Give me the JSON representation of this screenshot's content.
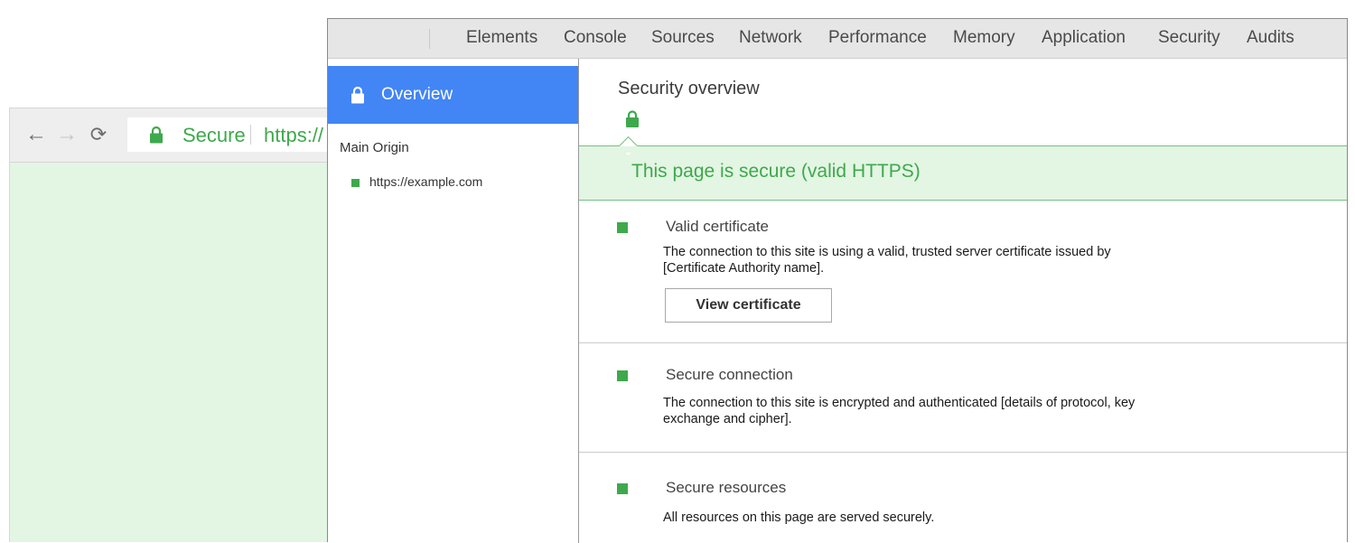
{
  "browser": {
    "address_bar": {
      "secure_label": "Secure",
      "url_text": "https://"
    }
  },
  "devtools": {
    "tabs": [
      {
        "label": "Elements"
      },
      {
        "label": "Console"
      },
      {
        "label": "Sources"
      },
      {
        "label": "Network"
      },
      {
        "label": "Performance"
      },
      {
        "label": "Memory"
      },
      {
        "label": "Application"
      },
      {
        "label": "Security"
      },
      {
        "label": "Audits"
      }
    ],
    "sidebar": {
      "overview_label": "Overview",
      "main_origin_heading": "Main Origin",
      "origins": [
        {
          "url": "https://example.com",
          "status": "secure"
        }
      ]
    },
    "main": {
      "title": "Security overview",
      "summary": "This page is secure (valid HTTPS)",
      "sections": [
        {
          "title": "Valid certificate",
          "description": "The connection to this site is using a valid, trusted server certificate issued by [Certificate Authority name].",
          "button_label": "View certificate"
        },
        {
          "title": "Secure connection",
          "description": "The connection to this site is encrypted and authenticated [details of protocol, key exchange and cipher]."
        },
        {
          "title": "Secure resources",
          "description": "All resources on this page are served securely."
        }
      ]
    }
  },
  "colors": {
    "secure_green": "#3ea94c",
    "secure_bg": "#e3f5e3",
    "selected_blue": "#4285f4"
  },
  "icons": {
    "back": "arrow-left-icon",
    "forward": "arrow-right-icon",
    "reload": "reload-icon",
    "lock": "lock-icon",
    "origin_status": "square-icon"
  }
}
